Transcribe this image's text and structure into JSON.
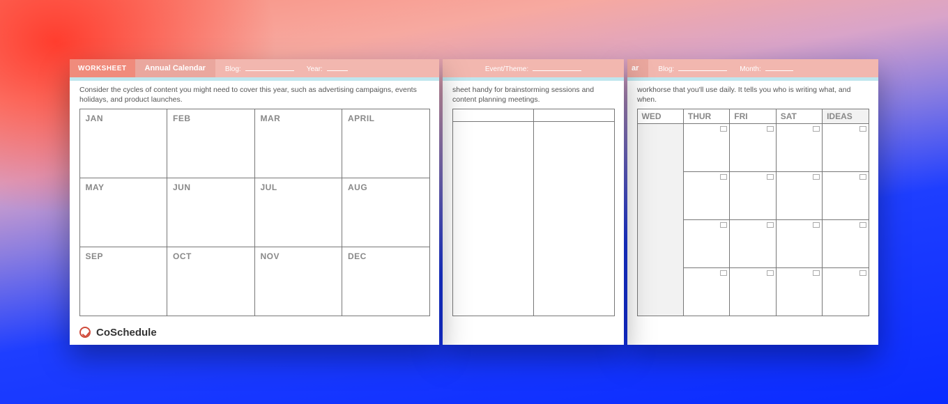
{
  "brand": "CoSchedule",
  "sheet1": {
    "tag": "WORKSHEET",
    "title": "Annual Calendar",
    "meta": {
      "blog": "Blog:",
      "year": "Year:"
    },
    "description": "Consider the cycles of content you might need to cover this year, such as advertising campaigns, events holidays, and product launches.",
    "months": [
      "JAN",
      "FEB",
      "MAR",
      "APRIL",
      "MAY",
      "JUN",
      "JUL",
      "AUG",
      "SEP",
      "OCT",
      "NOV",
      "DEC"
    ]
  },
  "sheet2": {
    "meta": {
      "event": "Event/Theme:"
    },
    "description": "sheet handy for brainstorming sessions and content planning meetings."
  },
  "sheet3": {
    "title_fragment": "ar",
    "meta": {
      "blog": "Blog:",
      "month": "Month:"
    },
    "description": "workhorse that you'll use daily. It tells you who is writing what, and when.",
    "days": [
      "WED",
      "THUR",
      "FRI",
      "SAT",
      "IDEAS"
    ]
  }
}
